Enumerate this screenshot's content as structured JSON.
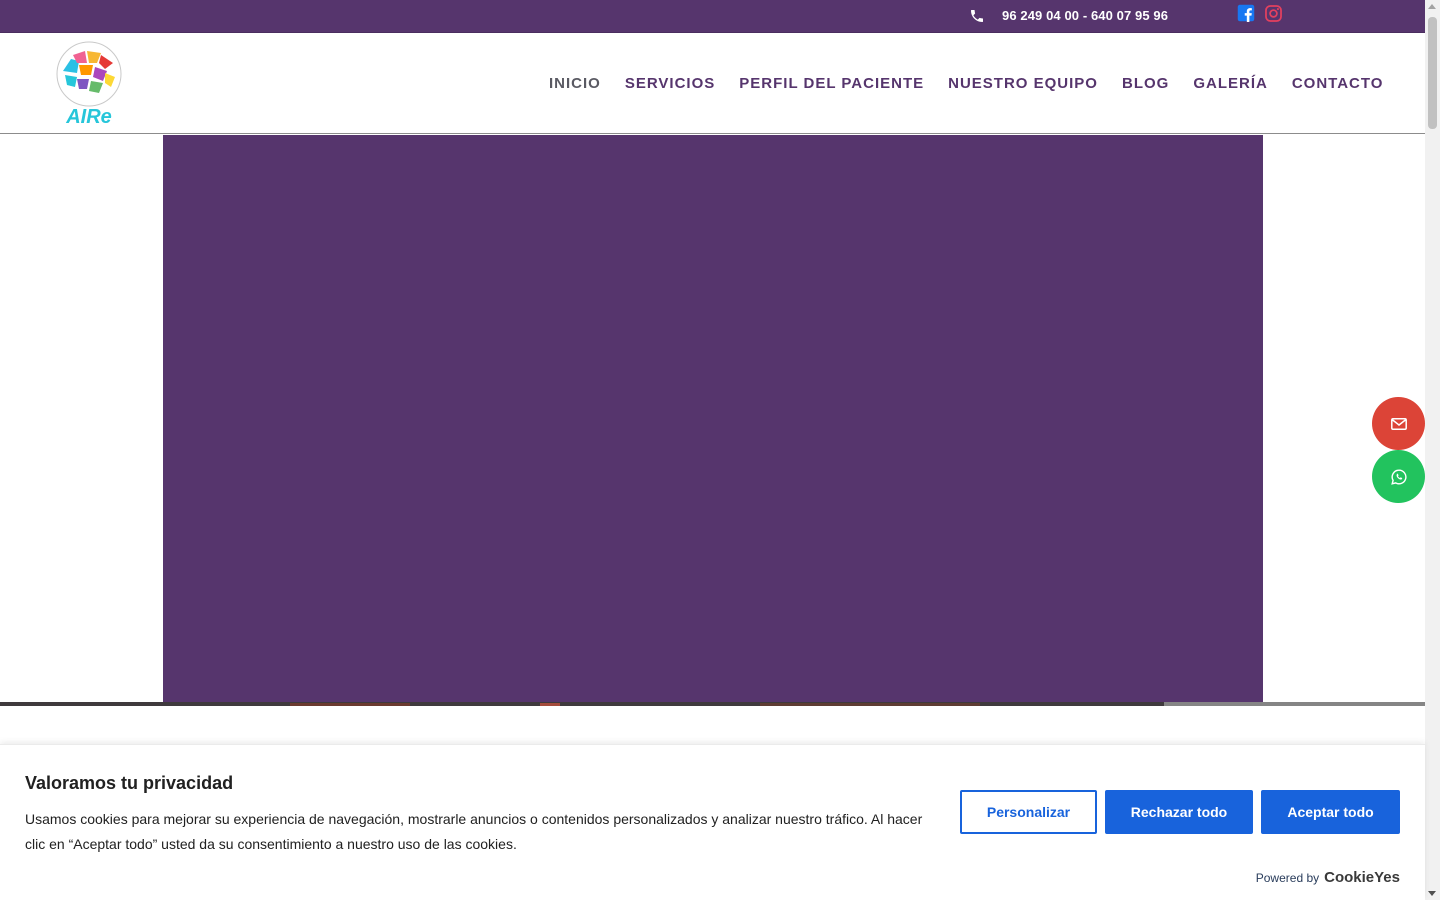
{
  "topbar": {
    "phone": "96 249 04 00 - 640 07 95 96",
    "phone_icon": "phone-icon",
    "social": [
      {
        "name": "facebook-icon",
        "color": "#1877f2"
      },
      {
        "name": "instagram-icon",
        "color": "#e4405f"
      }
    ]
  },
  "header": {
    "logo_text": "AIRe",
    "nav": [
      {
        "label": "INICIO",
        "active": true
      },
      {
        "label": "SERVICIOS",
        "active": false
      },
      {
        "label": "PERFIL DEL PACIENTE",
        "active": false
      },
      {
        "label": "NUESTRO EQUIPO",
        "active": false
      },
      {
        "label": "BLOG",
        "active": false
      },
      {
        "label": "GALERÍA",
        "active": false
      },
      {
        "label": "CONTACTO",
        "active": false
      }
    ]
  },
  "floating": {
    "mail_icon": "mail-icon",
    "whatsapp_icon": "whatsapp-icon"
  },
  "cookie": {
    "title": "Valoramos tu privacidad",
    "text": "Usamos cookies para mejorar su experiencia de navegación, mostrarle anuncios o contenidos personalizados y analizar nuestro tráfico. Al hacer clic en “Aceptar todo” usted da su consentimiento a nuestro uso de las cookies.",
    "customize_label": "Personalizar",
    "reject_label": "Rechazar todo",
    "accept_label": "Aceptar todo",
    "powered_label": "Powered by",
    "powered_brand": "CookieYes"
  },
  "colors": {
    "brand_purple": "#56356d",
    "cookie_blue": "#1863dc",
    "mail_red": "#dc4437",
    "whatsapp_green": "#22c35e"
  }
}
